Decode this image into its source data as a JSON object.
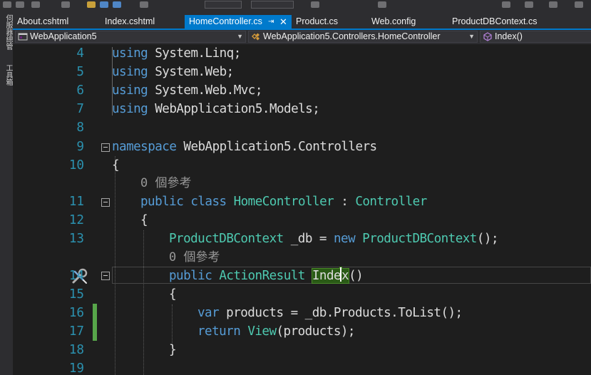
{
  "left_panel": {
    "server_explorer_label": "伺服器總管",
    "toolbox_label": "工具箱"
  },
  "tabs": [
    {
      "label": "About.cshtml",
      "active": false
    },
    {
      "label": "Index.cshtml",
      "active": false
    },
    {
      "label": "HomeController.cs",
      "active": true,
      "pin": "⇥",
      "close": "✕"
    },
    {
      "label": "Product.cs",
      "active": false
    },
    {
      "label": "Web.config",
      "active": false
    },
    {
      "label": "ProductDBContext.cs",
      "active": false
    }
  ],
  "navbar": {
    "project": "WebApplication5",
    "class": "WebApplication5.Controllers.HomeController",
    "member": "Index()"
  },
  "references_lens": "0 個參考",
  "lines": [
    {
      "num": "4",
      "text": "using System.Linq;"
    },
    {
      "num": "5",
      "text": "using System.Web;"
    },
    {
      "num": "6",
      "text": "using System.Web.Mvc;"
    },
    {
      "num": "7",
      "text": "using WebApplication5.Models;"
    },
    {
      "num": "8",
      "text": ""
    },
    {
      "num": "9",
      "text": "namespace WebApplication5.Controllers"
    },
    {
      "num": "10",
      "text": "{"
    },
    {
      "num": "11",
      "text": "public class HomeController : Controller"
    },
    {
      "num": "12",
      "text": "{"
    },
    {
      "num": "13",
      "text": "ProductDBContext _db = new ProductDBContext();"
    },
    {
      "num": "14",
      "text": "public ActionResult Index()"
    },
    {
      "num": "15",
      "text": "{"
    },
    {
      "num": "16",
      "text": "var products = _db.Products.ToList();"
    },
    {
      "num": "17",
      "text": "return View(products);"
    },
    {
      "num": "18",
      "text": "}"
    },
    {
      "num": "19",
      "text": ""
    }
  ],
  "colors": {
    "background": "#1e1e1e",
    "keyword": "#569cd6",
    "type": "#4ec9b0",
    "line_number": "#2b91af",
    "tab_active": "#007acc",
    "change_bar": "#57a64a",
    "reference_highlight": "#2a5a16"
  },
  "icons": {
    "project_icon": "csharp-project-icon",
    "class_icon": "class-icon",
    "member_icon": "method-icon",
    "quick_action_icon": "wrench-screwdriver-icon"
  }
}
